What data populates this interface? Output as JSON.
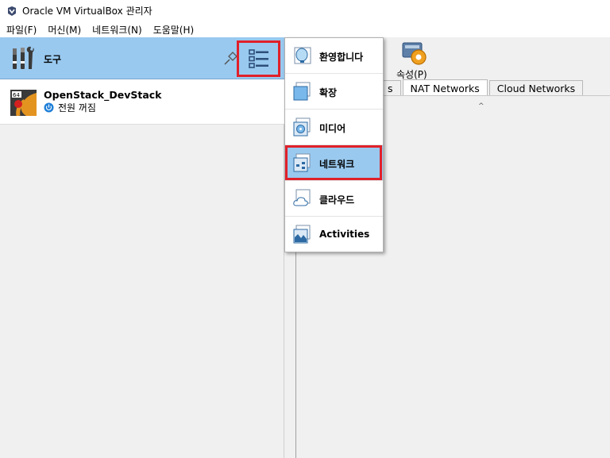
{
  "window": {
    "title": "Oracle VM VirtualBox 관리자"
  },
  "menubar": {
    "items": [
      "파일(F)",
      "머신(M)",
      "네트워크(N)",
      "도움말(H)"
    ]
  },
  "tools": {
    "label": "도구"
  },
  "vm": {
    "name": "OpenStack_DevStack",
    "state": "전원 꺼짐",
    "os_badge": "64"
  },
  "toolbar": {
    "properties_label": "속성(P)"
  },
  "tabs": {
    "partial_label": "s",
    "nat": "NAT Networks",
    "cloud": "Cloud Networks"
  },
  "dropdown": {
    "items": [
      {
        "label": "환영합니다",
        "icon": "welcome-icon"
      },
      {
        "label": "확장",
        "icon": "extension-icon"
      },
      {
        "label": "미디어",
        "icon": "media-icon"
      },
      {
        "label": "네트워크",
        "icon": "network-icon",
        "selected": true
      },
      {
        "label": "클라우드",
        "icon": "cloud-icon"
      },
      {
        "label": "Activities",
        "icon": "activities-icon"
      }
    ]
  },
  "colors": {
    "highlight_red": "#e0202a",
    "selection_blue": "#99c9ef"
  }
}
